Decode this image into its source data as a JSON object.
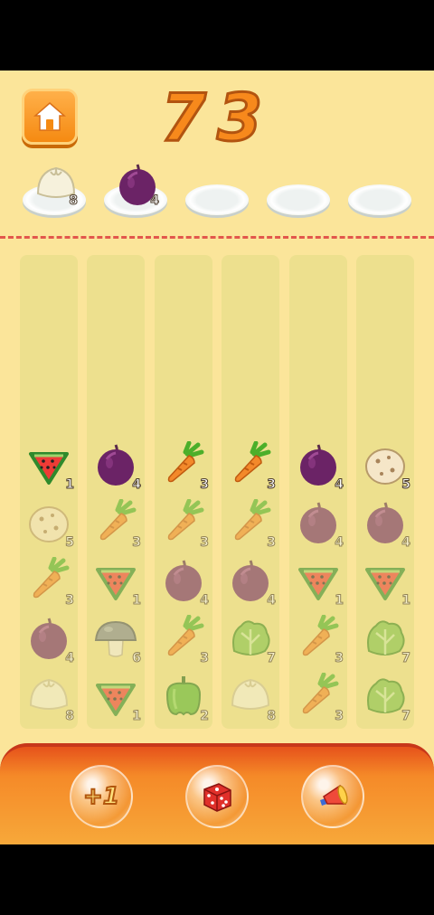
{
  "score": "73",
  "plates": [
    {
      "item": "dumpling",
      "count": "8"
    },
    {
      "item": "onion",
      "count": "4"
    },
    {
      "item": "",
      "count": ""
    },
    {
      "item": "",
      "count": ""
    },
    {
      "item": "",
      "count": ""
    }
  ],
  "columns": [
    {
      "cells": [
        {
          "item": "watermelon",
          "count": "1",
          "active": true
        },
        {
          "item": "potato",
          "count": "5",
          "active": false
        },
        {
          "item": "carrot",
          "count": "3",
          "active": false
        },
        {
          "item": "onion",
          "count": "4",
          "active": false
        },
        {
          "item": "dumpling",
          "count": "8",
          "active": false
        }
      ]
    },
    {
      "cells": [
        {
          "item": "onion",
          "count": "4",
          "active": true
        },
        {
          "item": "carrot",
          "count": "3",
          "active": false
        },
        {
          "item": "watermelon",
          "count": "1",
          "active": false
        },
        {
          "item": "mushroom",
          "count": "6",
          "active": false
        },
        {
          "item": "watermelon",
          "count": "1",
          "active": false
        }
      ]
    },
    {
      "cells": [
        {
          "item": "carrot",
          "count": "3",
          "active": true
        },
        {
          "item": "carrot",
          "count": "3",
          "active": false
        },
        {
          "item": "onion",
          "count": "4",
          "active": false
        },
        {
          "item": "carrot",
          "count": "3",
          "active": false
        },
        {
          "item": "pepper",
          "count": "2",
          "active": false
        }
      ]
    },
    {
      "cells": [
        {
          "item": "carrot",
          "count": "3",
          "active": true
        },
        {
          "item": "carrot",
          "count": "3",
          "active": false
        },
        {
          "item": "onion",
          "count": "4",
          "active": false
        },
        {
          "item": "lettuce",
          "count": "7",
          "active": false
        },
        {
          "item": "dumpling",
          "count": "8",
          "active": false
        }
      ]
    },
    {
      "cells": [
        {
          "item": "onion",
          "count": "4",
          "active": true
        },
        {
          "item": "onion",
          "count": "4",
          "active": false
        },
        {
          "item": "watermelon",
          "count": "1",
          "active": false
        },
        {
          "item": "carrot",
          "count": "3",
          "active": false
        },
        {
          "item": "carrot",
          "count": "3",
          "active": false
        }
      ]
    },
    {
      "cells": [
        {
          "item": "potato",
          "count": "5",
          "active": true
        },
        {
          "item": "onion",
          "count": "4",
          "active": false
        },
        {
          "item": "watermelon",
          "count": "1",
          "active": false
        },
        {
          "item": "lettuce",
          "count": "7",
          "active": false
        },
        {
          "item": "lettuce",
          "count": "7",
          "active": false
        }
      ]
    }
  ],
  "powerups": {
    "plus_one": "+1",
    "dice_icon": "dice-icon",
    "horn_icon": "horn-icon"
  },
  "colors": {
    "background": "#fbe59a",
    "score": "#f7891c",
    "divider": "#e2574c",
    "bottom_bar": "#f58a28"
  }
}
